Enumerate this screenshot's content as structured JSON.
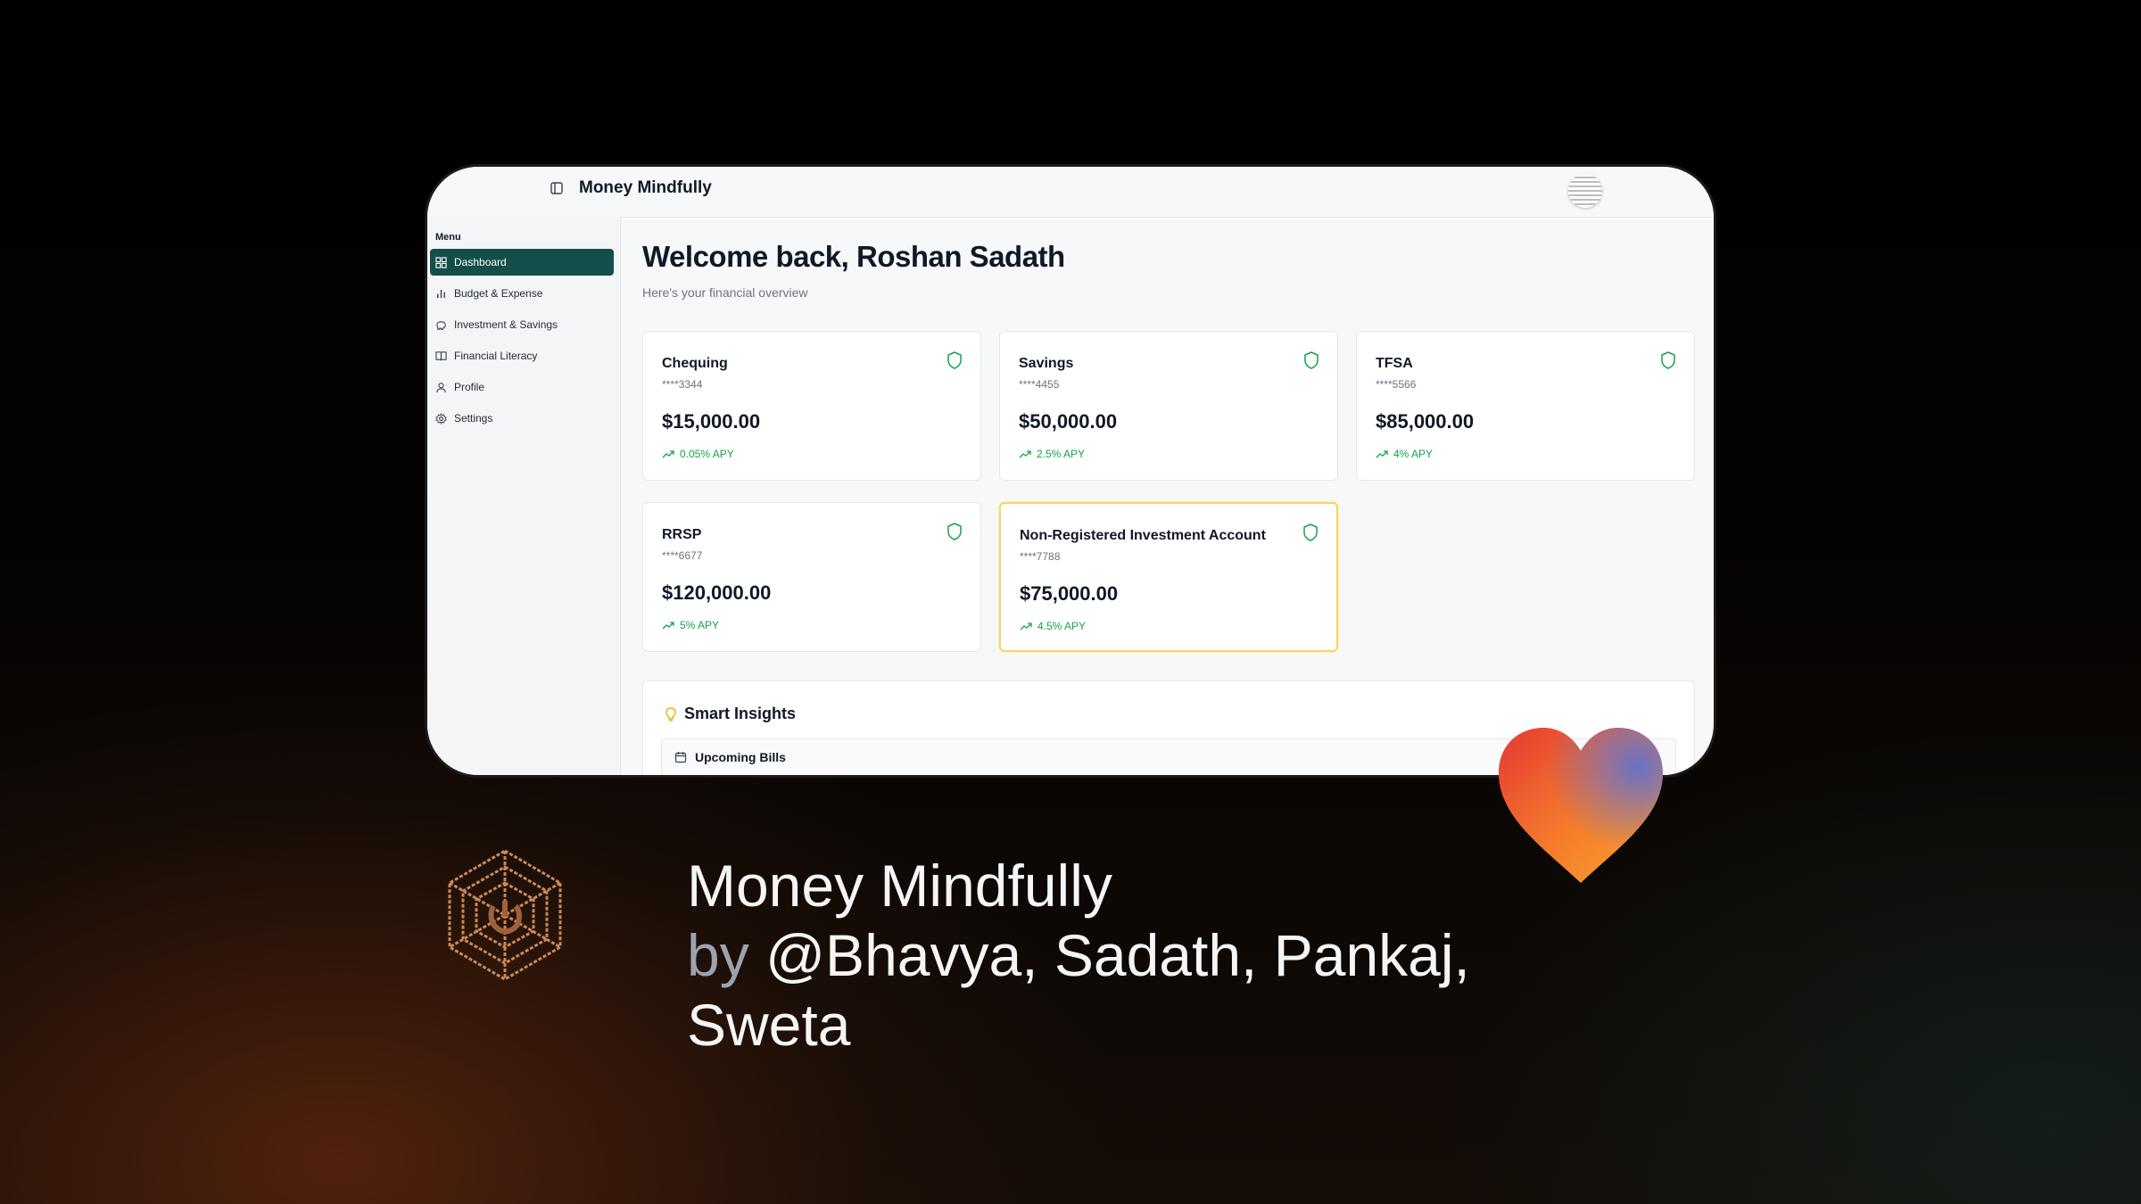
{
  "app": {
    "title": "Money Mindfully"
  },
  "sidebar": {
    "menu_label": "Menu",
    "items": [
      {
        "label": "Dashboard",
        "icon": "grid-icon",
        "active": true
      },
      {
        "label": "Budget & Expense",
        "icon": "bar-chart-icon",
        "active": false
      },
      {
        "label": "Investment & Savings",
        "icon": "piggy-bank-icon",
        "active": false
      },
      {
        "label": "Financial Literacy",
        "icon": "book-icon",
        "active": false
      },
      {
        "label": "Profile",
        "icon": "user-icon",
        "active": false
      },
      {
        "label": "Settings",
        "icon": "gear-icon",
        "active": false
      }
    ]
  },
  "main": {
    "welcome": "Welcome back, Roshan Sadath",
    "subtitle": "Here's your financial overview",
    "accounts": [
      {
        "name": "Chequing",
        "number": "****3344",
        "balance": "$15,000.00",
        "apy": "0.05% APY"
      },
      {
        "name": "Savings",
        "number": "****4455",
        "balance": "$50,000.00",
        "apy": "2.5% APY"
      },
      {
        "name": "TFSA",
        "number": "****5566",
        "balance": "$85,000.00",
        "apy": "4% APY"
      },
      {
        "name": "RRSP",
        "number": "****6677",
        "balance": "$120,000.00",
        "apy": "5% APY"
      },
      {
        "name": "Non-Registered Investment Account",
        "number": "****7788",
        "balance": "$75,000.00",
        "apy": "4.5% APY",
        "highlighted": true
      }
    ],
    "insights": {
      "title": "Smart Insights",
      "upcoming_bills": "Upcoming Bills"
    }
  },
  "footer": {
    "project_name": "Money Mindfully",
    "by": "by",
    "authors": "@Bhavya, Sadath, Pankaj, Sweta"
  },
  "colors": {
    "active_nav": "#134e4a",
    "apy_green": "#16a34a",
    "highlight_border": "#f5d565",
    "logo_copper": "#c98a5a"
  }
}
